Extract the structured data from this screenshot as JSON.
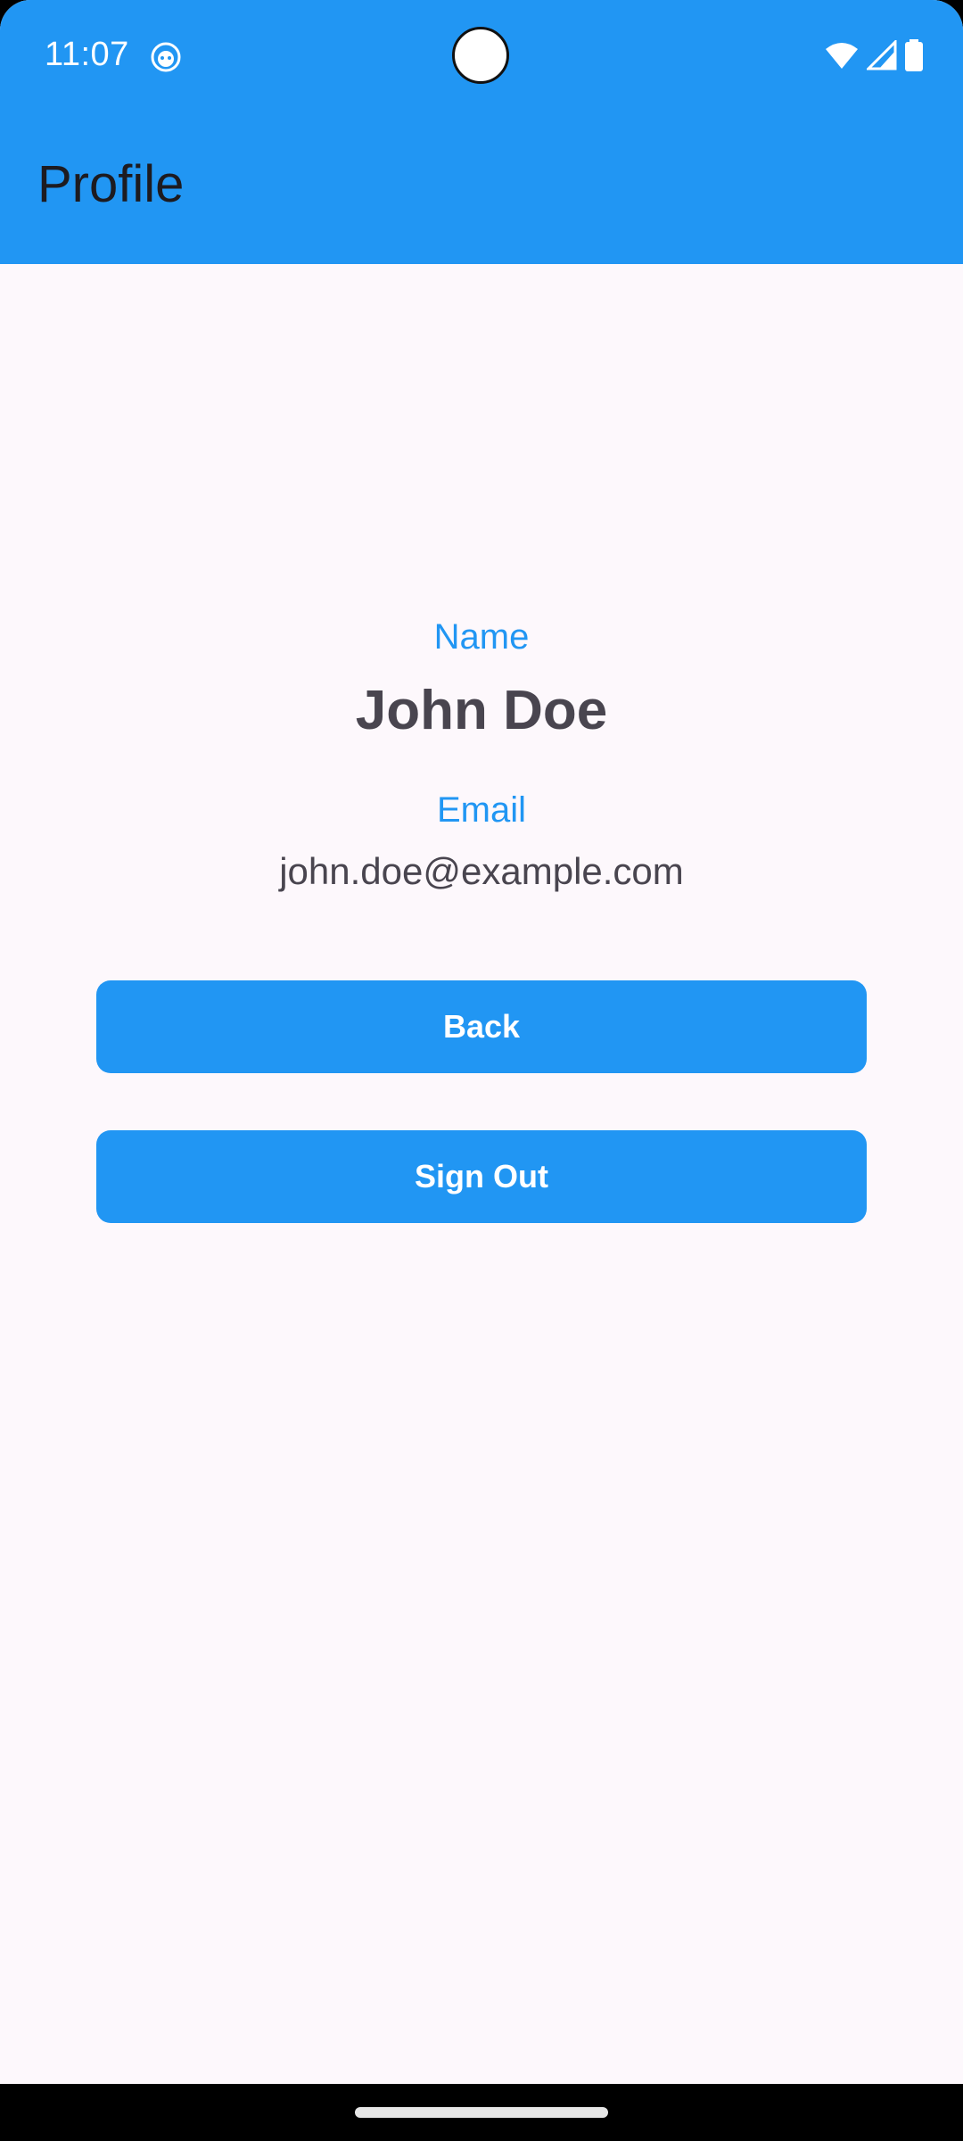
{
  "status_bar": {
    "time": "11:07",
    "app_icon": "android-debug-icon",
    "icons": [
      "wifi-icon",
      "cell-signal-icon",
      "battery-icon"
    ]
  },
  "toolbar": {
    "title": "Profile"
  },
  "profile": {
    "name_label": "Name",
    "name_value": "John Doe",
    "email_label": "Email",
    "email_value": "john.doe@example.com"
  },
  "actions": {
    "back_label": "Back",
    "sign_out_label": "Sign Out"
  },
  "colors": {
    "primary": "#2196f3",
    "background": "#fdf8fc",
    "text_secondary": "#49454f",
    "toolbar_text": "#1d1b20"
  }
}
